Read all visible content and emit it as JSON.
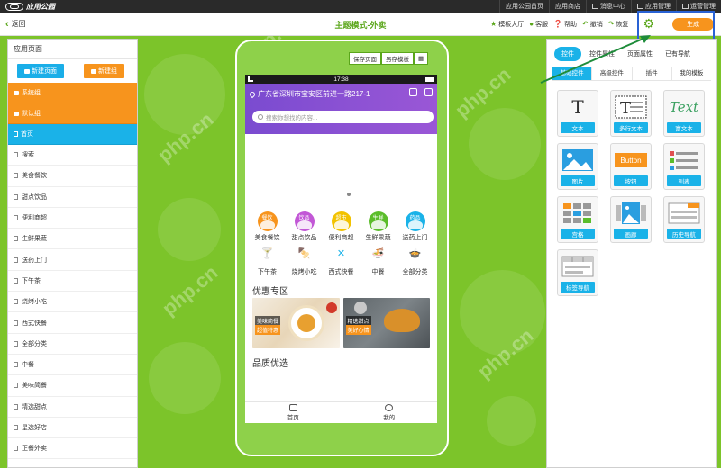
{
  "topbar": {
    "logo": "应用公园",
    "links": [
      "应用公园首页",
      "应用商店",
      "消息中心",
      "应用管理",
      "运营管理"
    ]
  },
  "navbar": {
    "back_label": "返回",
    "title": "主题模式-外卖",
    "tools": [
      "模板大厅",
      "客服",
      "帮助",
      "撤销",
      "恢复"
    ],
    "generate_label": "生成"
  },
  "left_panel": {
    "title": "应用页面",
    "new_page_label": "新建页面",
    "new_group_label": "新建组",
    "groups": [
      "系统组",
      "默认组"
    ],
    "selected_page": "首页",
    "pages": [
      "搜索",
      "美食餐饮",
      "甜点饮品",
      "便利商超",
      "生鲜果蔬",
      "送药上门",
      "下午茶",
      "烧烤小吃",
      "西式快餐",
      "全部分类",
      "中餐",
      "美味简餐",
      "精选甜点",
      "星选好店",
      "正餐外卖"
    ]
  },
  "phone": {
    "save_page_label": "保存页面",
    "save_as_template_label": "另存模板",
    "qr_label": "▦",
    "time": "17:38",
    "location": "广东省深圳市宝安区前进一路217-1",
    "search_placeholder": "搜索你想找的内容...",
    "categories": [
      {
        "tag": "餐饮",
        "label": "美食餐饮",
        "color": "#f7941d"
      },
      {
        "tag": "饮品",
        "label": "甜点饮品",
        "color": "#c257d6"
      },
      {
        "tag": "超市",
        "label": "便利商超",
        "color": "#f2c200"
      },
      {
        "tag": "生鲜",
        "label": "生鲜果蔬",
        "color": "#5bbd2b"
      },
      {
        "tag": "药品",
        "label": "送药上门",
        "color": "#1ab2e8"
      }
    ],
    "categories2": [
      {
        "label": "下午茶",
        "glyph": "🍸",
        "color": "#e056b0"
      },
      {
        "label": "烧烤小吃",
        "glyph": "🍢",
        "color": "#f7941d"
      },
      {
        "label": "西式快餐",
        "glyph": "✕",
        "color": "#1ab2e8"
      },
      {
        "label": "中餐",
        "glyph": "🍜",
        "color": "#5bbd2b"
      },
      {
        "label": "全部分类",
        "glyph": "🍲",
        "color": "#f2a200"
      }
    ],
    "promo_title": "优惠专区",
    "promos": [
      {
        "title": "美味简餐",
        "subtitle": "超值特惠"
      },
      {
        "title": "精选甜点",
        "subtitle": "美好心情"
      }
    ],
    "quality_title": "品质优选",
    "tabs": [
      "首页",
      "我的"
    ]
  },
  "right_panel": {
    "tabs": [
      "控件",
      "控件属性",
      "页面属性",
      "已有导航"
    ],
    "subtabs": [
      "基础控件",
      "高级控件",
      "插件",
      "我的模板"
    ],
    "widgets": [
      {
        "label": "文本",
        "icon": "text-icon"
      },
      {
        "label": "多行文本",
        "icon": "multiline-text-icon"
      },
      {
        "label": "富文本",
        "icon": "rich-text-icon"
      },
      {
        "label": "图片",
        "icon": "image-icon"
      },
      {
        "label": "按钮",
        "icon": "button-icon"
      },
      {
        "label": "列表",
        "icon": "list-icon"
      },
      {
        "label": "宫格",
        "icon": "grid-icon"
      },
      {
        "label": "画廊",
        "icon": "gallery-icon"
      },
      {
        "label": "历史导航",
        "icon": "history-nav-icon"
      },
      {
        "label": "标签导航",
        "icon": "tab-nav-icon"
      }
    ],
    "button_preview_text": "Button",
    "text_preview_text": "Text",
    "big_t": "T"
  },
  "watermark": "php.cn",
  "colors": {
    "background": "#7cc42a",
    "accent_blue": "#1ab2e8",
    "accent_orange": "#f7941d",
    "brand_green": "#5aa61a",
    "highlight": "#2962d4"
  }
}
